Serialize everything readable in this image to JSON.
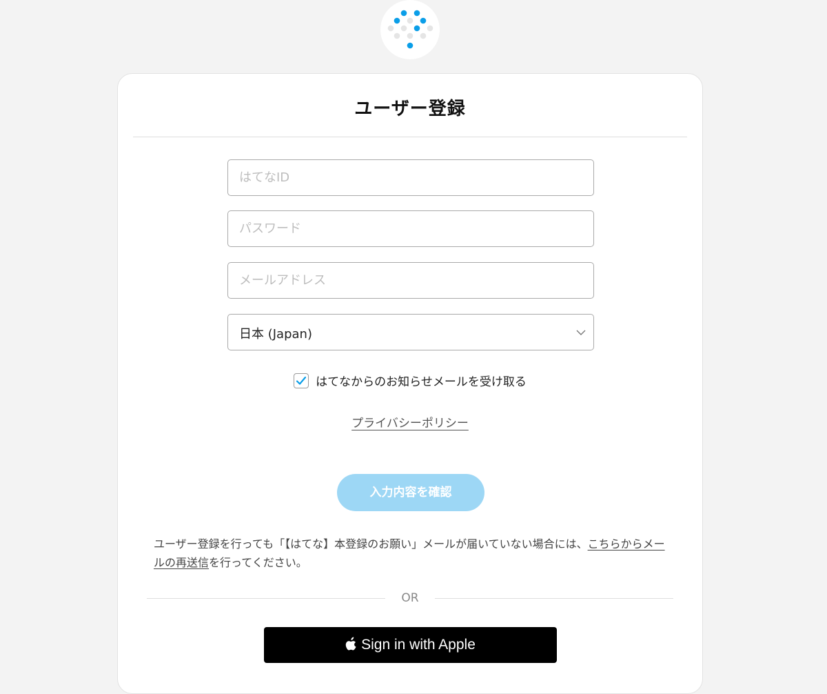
{
  "logo": {
    "icon": "hatena-dots-logo-icon",
    "brand_color": "#0a9ee8",
    "dot_grey": "#e5e5e5"
  },
  "card": {
    "title": "ユーザー登録"
  },
  "form": {
    "hatena_id": {
      "placeholder": "はてなID",
      "value": ""
    },
    "password": {
      "placeholder": "パスワード",
      "value": ""
    },
    "email": {
      "placeholder": "メールアドレス",
      "value": ""
    },
    "country": {
      "selected": "日本 (Japan)"
    },
    "newsletter": {
      "label": "はてなからのお知らせメールを受け取る",
      "checked": true,
      "check_color": "#0a9ee8"
    },
    "privacy_link": "プライバシーポリシー",
    "confirm_button": "入力内容を確認"
  },
  "notice": {
    "text_before": "ユーザー登録を行っても「【はてな】本登録のお願い」メールが届いていない場合には、",
    "link": "こちらからメールの再送信",
    "text_after": "を行ってください。"
  },
  "divider": {
    "or_text": "OR"
  },
  "apple_button": {
    "label": "Sign in with Apple",
    "icon": "apple-icon"
  }
}
